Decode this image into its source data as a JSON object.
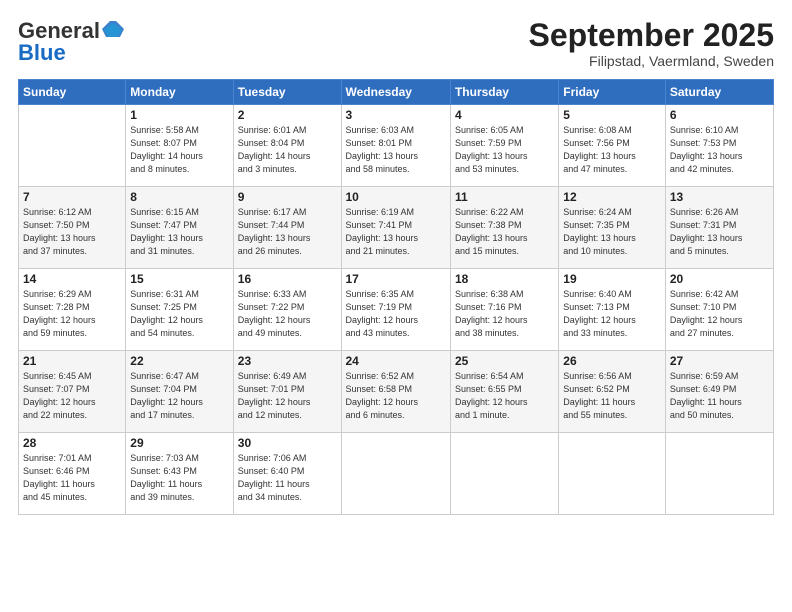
{
  "header": {
    "logo_general": "General",
    "logo_blue": "Blue",
    "month_title": "September 2025",
    "subtitle": "Filipstad, Vaermland, Sweden"
  },
  "weekdays": [
    "Sunday",
    "Monday",
    "Tuesday",
    "Wednesday",
    "Thursday",
    "Friday",
    "Saturday"
  ],
  "weeks": [
    [
      {
        "day": "",
        "info": ""
      },
      {
        "day": "1",
        "info": "Sunrise: 5:58 AM\nSunset: 8:07 PM\nDaylight: 14 hours\nand 8 minutes."
      },
      {
        "day": "2",
        "info": "Sunrise: 6:01 AM\nSunset: 8:04 PM\nDaylight: 14 hours\nand 3 minutes."
      },
      {
        "day": "3",
        "info": "Sunrise: 6:03 AM\nSunset: 8:01 PM\nDaylight: 13 hours\nand 58 minutes."
      },
      {
        "day": "4",
        "info": "Sunrise: 6:05 AM\nSunset: 7:59 PM\nDaylight: 13 hours\nand 53 minutes."
      },
      {
        "day": "5",
        "info": "Sunrise: 6:08 AM\nSunset: 7:56 PM\nDaylight: 13 hours\nand 47 minutes."
      },
      {
        "day": "6",
        "info": "Sunrise: 6:10 AM\nSunset: 7:53 PM\nDaylight: 13 hours\nand 42 minutes."
      }
    ],
    [
      {
        "day": "7",
        "info": "Sunrise: 6:12 AM\nSunset: 7:50 PM\nDaylight: 13 hours\nand 37 minutes."
      },
      {
        "day": "8",
        "info": "Sunrise: 6:15 AM\nSunset: 7:47 PM\nDaylight: 13 hours\nand 31 minutes."
      },
      {
        "day": "9",
        "info": "Sunrise: 6:17 AM\nSunset: 7:44 PM\nDaylight: 13 hours\nand 26 minutes."
      },
      {
        "day": "10",
        "info": "Sunrise: 6:19 AM\nSunset: 7:41 PM\nDaylight: 13 hours\nand 21 minutes."
      },
      {
        "day": "11",
        "info": "Sunrise: 6:22 AM\nSunset: 7:38 PM\nDaylight: 13 hours\nand 15 minutes."
      },
      {
        "day": "12",
        "info": "Sunrise: 6:24 AM\nSunset: 7:35 PM\nDaylight: 13 hours\nand 10 minutes."
      },
      {
        "day": "13",
        "info": "Sunrise: 6:26 AM\nSunset: 7:31 PM\nDaylight: 13 hours\nand 5 minutes."
      }
    ],
    [
      {
        "day": "14",
        "info": "Sunrise: 6:29 AM\nSunset: 7:28 PM\nDaylight: 12 hours\nand 59 minutes."
      },
      {
        "day": "15",
        "info": "Sunrise: 6:31 AM\nSunset: 7:25 PM\nDaylight: 12 hours\nand 54 minutes."
      },
      {
        "day": "16",
        "info": "Sunrise: 6:33 AM\nSunset: 7:22 PM\nDaylight: 12 hours\nand 49 minutes."
      },
      {
        "day": "17",
        "info": "Sunrise: 6:35 AM\nSunset: 7:19 PM\nDaylight: 12 hours\nand 43 minutes."
      },
      {
        "day": "18",
        "info": "Sunrise: 6:38 AM\nSunset: 7:16 PM\nDaylight: 12 hours\nand 38 minutes."
      },
      {
        "day": "19",
        "info": "Sunrise: 6:40 AM\nSunset: 7:13 PM\nDaylight: 12 hours\nand 33 minutes."
      },
      {
        "day": "20",
        "info": "Sunrise: 6:42 AM\nSunset: 7:10 PM\nDaylight: 12 hours\nand 27 minutes."
      }
    ],
    [
      {
        "day": "21",
        "info": "Sunrise: 6:45 AM\nSunset: 7:07 PM\nDaylight: 12 hours\nand 22 minutes."
      },
      {
        "day": "22",
        "info": "Sunrise: 6:47 AM\nSunset: 7:04 PM\nDaylight: 12 hours\nand 17 minutes."
      },
      {
        "day": "23",
        "info": "Sunrise: 6:49 AM\nSunset: 7:01 PM\nDaylight: 12 hours\nand 12 minutes."
      },
      {
        "day": "24",
        "info": "Sunrise: 6:52 AM\nSunset: 6:58 PM\nDaylight: 12 hours\nand 6 minutes."
      },
      {
        "day": "25",
        "info": "Sunrise: 6:54 AM\nSunset: 6:55 PM\nDaylight: 12 hours\nand 1 minute."
      },
      {
        "day": "26",
        "info": "Sunrise: 6:56 AM\nSunset: 6:52 PM\nDaylight: 11 hours\nand 55 minutes."
      },
      {
        "day": "27",
        "info": "Sunrise: 6:59 AM\nSunset: 6:49 PM\nDaylight: 11 hours\nand 50 minutes."
      }
    ],
    [
      {
        "day": "28",
        "info": "Sunrise: 7:01 AM\nSunset: 6:46 PM\nDaylight: 11 hours\nand 45 minutes."
      },
      {
        "day": "29",
        "info": "Sunrise: 7:03 AM\nSunset: 6:43 PM\nDaylight: 11 hours\nand 39 minutes."
      },
      {
        "day": "30",
        "info": "Sunrise: 7:06 AM\nSunset: 6:40 PM\nDaylight: 11 hours\nand 34 minutes."
      },
      {
        "day": "",
        "info": ""
      },
      {
        "day": "",
        "info": ""
      },
      {
        "day": "",
        "info": ""
      },
      {
        "day": "",
        "info": ""
      }
    ]
  ]
}
